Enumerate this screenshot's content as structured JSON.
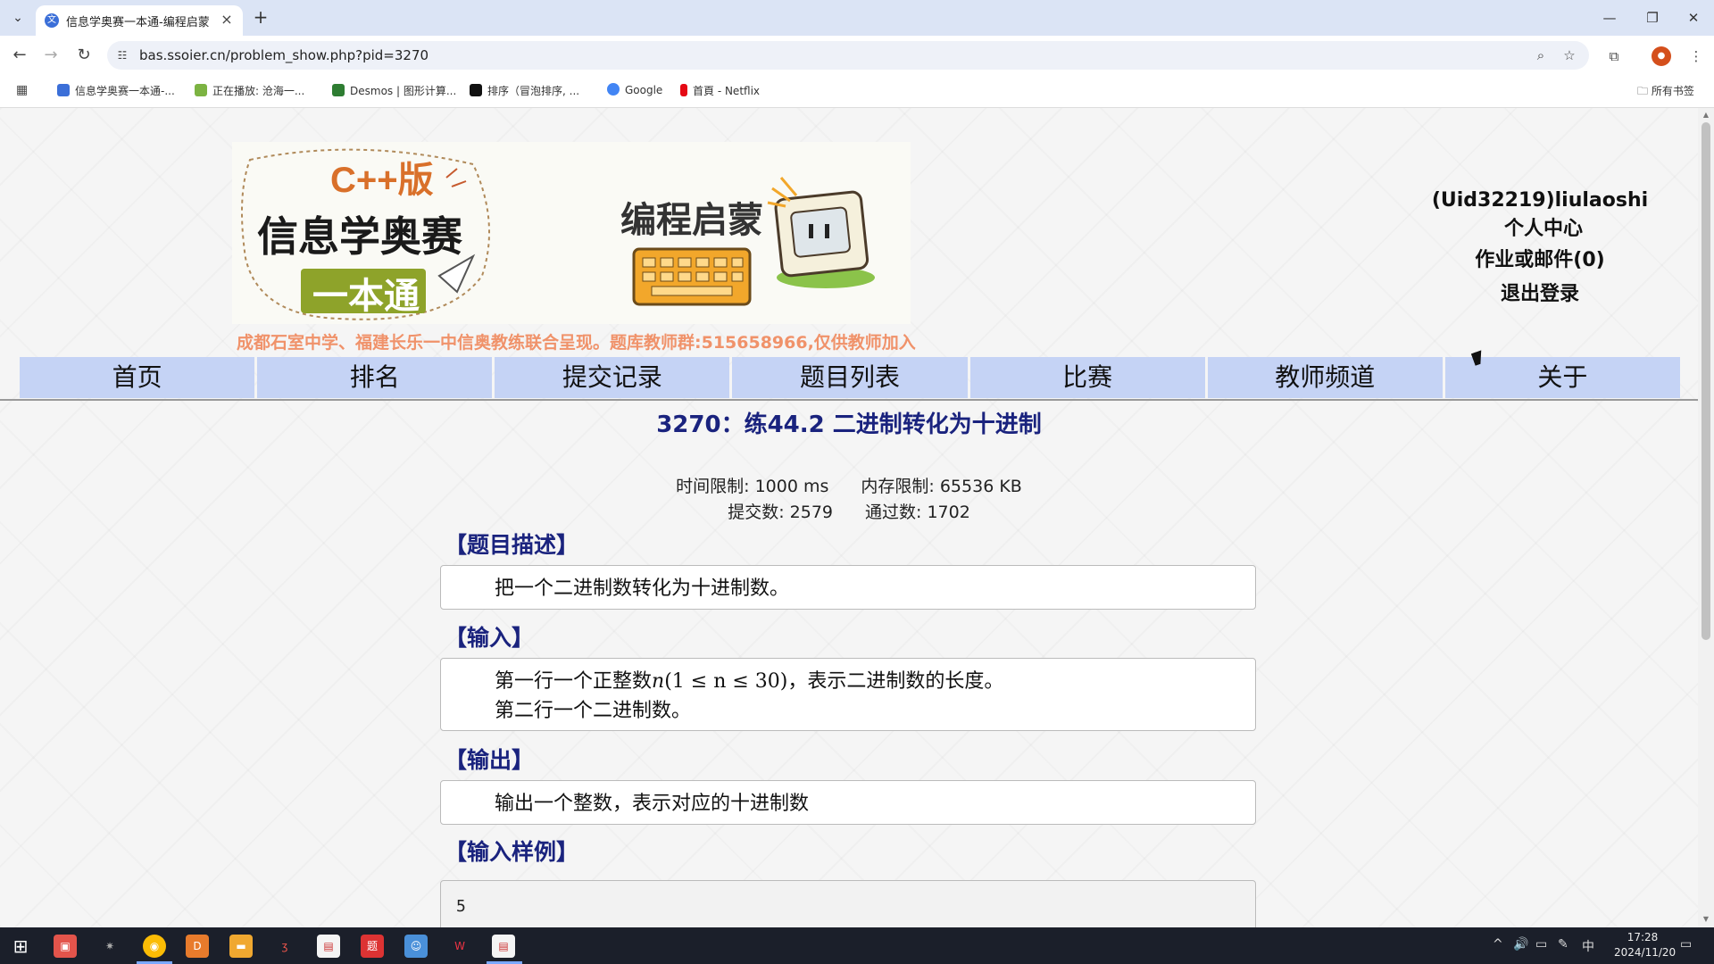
{
  "browser": {
    "tab_title": "信息学奥赛一本通-编程启蒙（C",
    "url": "bas.ssoier.cn/problem_show.php?pid=3270",
    "bookmarks": [
      {
        "label": "信息学奥赛一本通-...",
        "color": "#3b6fd8"
      },
      {
        "label": "正在播放: 沧海一...",
        "color": "#7cb342"
      },
      {
        "label": "Desmos | 图形计算...",
        "color": "#2e7d32"
      },
      {
        "label": "排序（冒泡排序, ...",
        "color": "#111111"
      },
      {
        "label": "Google",
        "color": "#4285f4"
      },
      {
        "label": "首頁 - Netflix",
        "color": "#e50914"
      }
    ],
    "all_bookmarks": "所有书签"
  },
  "banner": {
    "edition": "C++版",
    "title_line1": "信息学奥赛",
    "title_line2": "一本通",
    "subtitle": "编程启蒙",
    "tagline": "成都石室中学、福建长乐一中信奥教练联合呈现。题库教师群:515658966,仅供教师加入"
  },
  "user": {
    "name": "(Uid32219)liulaoshi",
    "center": "个人中心",
    "homework": "作业或邮件(0)",
    "logout": "退出登录"
  },
  "nav": [
    "首页",
    "排名",
    "提交记录",
    "题目列表",
    "比赛",
    "教师频道",
    "关于"
  ],
  "problem": {
    "title": "3270：练44.2 二进制转化为十进制",
    "time_limit": "时间限制: 1000 ms",
    "memory_limit": "内存限制: 65536 KB",
    "submissions": "提交数: 2579",
    "accepted": "通过数: 1702",
    "desc_title": "【题目描述】",
    "desc": "把一个二进制数转化为十进制数。",
    "input_title": "【输入】",
    "input_line1_pre": "第一行一个正整数",
    "input_line1_var": "n",
    "input_line1_math": "(1 ≤ n ≤ 30)",
    "input_line1_post": "，表示二进制数的长度。",
    "input_line2": "第二行一个二进制数。",
    "output_title": "【输出】",
    "output": "输出一个整数，表示对应的十进制数",
    "sample_input_title": "【输入样例】",
    "sample_input": "5"
  },
  "taskbar": {
    "time": "17:28",
    "date": "2024/11/20",
    "ime": "中"
  },
  "colors": {
    "nav_bg": "#c5d3f5",
    "title_blue": "#1a237e",
    "tagline_orange": "#f0926a"
  }
}
